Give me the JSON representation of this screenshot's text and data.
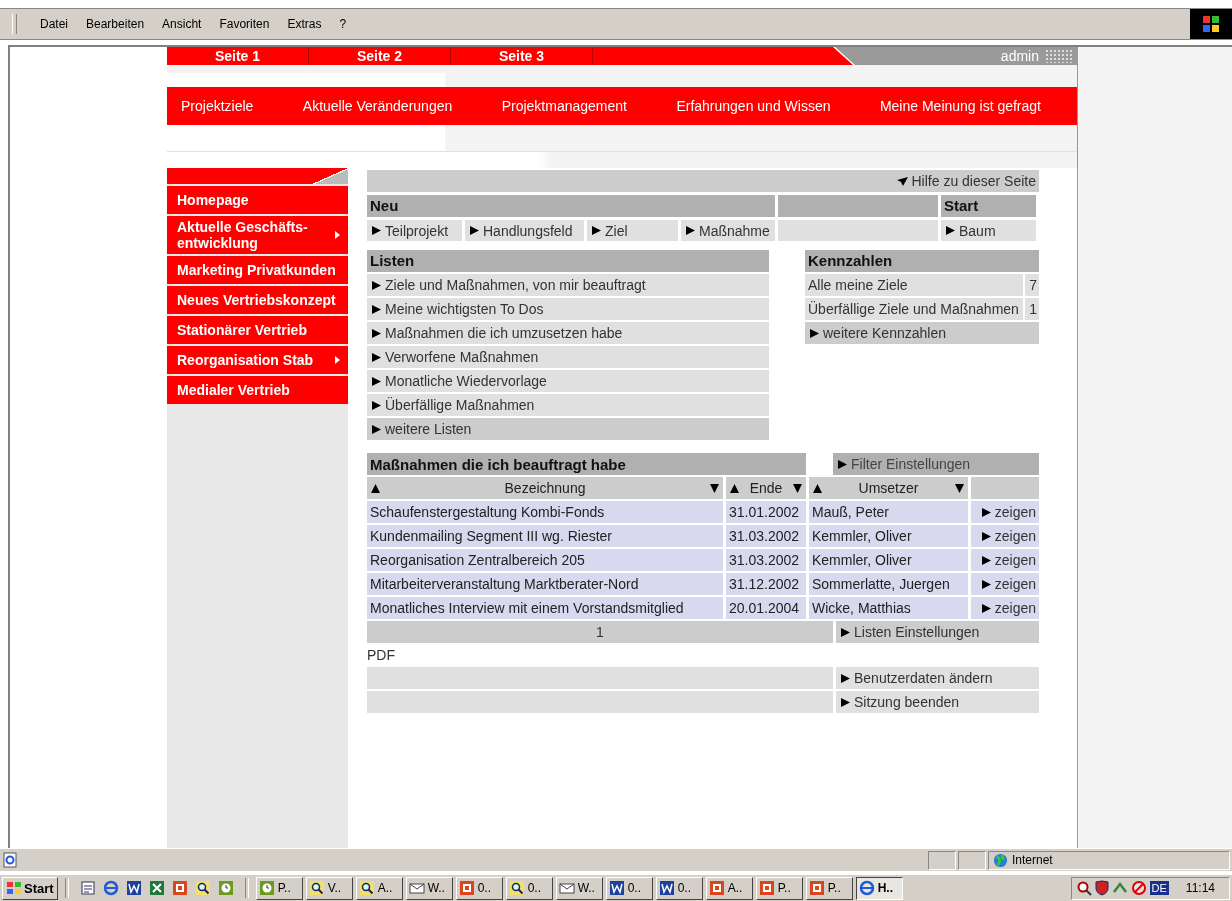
{
  "menu": [
    "Datei",
    "Bearbeiten",
    "Ansicht",
    "Favoriten",
    "Extras",
    "?"
  ],
  "page_tabs": [
    "Seite 1",
    "Seite 2",
    "Seite 3"
  ],
  "user": "admin",
  "nav": [
    "Projektziele",
    "Aktuelle Veränderungen",
    "Projektmanagement",
    "Erfahrungen und Wissen",
    "Meine Meinung ist gefragt"
  ],
  "sidebar": {
    "items": [
      {
        "label": "Homepage",
        "kind": "plain"
      },
      {
        "label": "Aktuelle Geschäfts-\nentwicklung",
        "kind": "submenu"
      },
      {
        "label": "Marketing Privatkunden",
        "kind": "plain"
      },
      {
        "label": "Neues Vertriebskonzept",
        "kind": "plain"
      },
      {
        "label": "Stationärer Vertrieb",
        "kind": "plain"
      },
      {
        "label": "Reorganisation Stab",
        "kind": "submenu"
      },
      {
        "label": "Medialer Vertrieb",
        "kind": "plain"
      }
    ]
  },
  "help_link": "Hilfe zu dieser Seite",
  "new_section": {
    "title": "Neu",
    "links": [
      "Teilprojekt",
      "Handlungsfeld",
      "Ziel",
      "Maßnahme"
    ],
    "start_title": "Start",
    "start_link": "Baum"
  },
  "lists": {
    "title": "Listen",
    "items": [
      {
        "label": "Ziele und Maßnahmen, von mir beauftragt",
        "kind": "link"
      },
      {
        "label": "Meine wichtigsten To Dos",
        "kind": "link"
      },
      {
        "label": "Maßnahmen die ich umzusetzen habe",
        "kind": "link"
      },
      {
        "label": "Verworfene Maßnahmen",
        "kind": "link"
      },
      {
        "label": "Monatliche Wiedervorlage",
        "kind": "link"
      },
      {
        "label": "Überfällige Maßnahmen",
        "kind": "link"
      },
      {
        "label": "weitere Listen",
        "kind": "more"
      }
    ]
  },
  "metrics": {
    "title": "Kennzahlen",
    "rows": [
      {
        "label": "Alle meine Ziele",
        "value": "7"
      },
      {
        "label": "Überfällige Ziele und Maßnahmen",
        "value": "1"
      }
    ],
    "more_link": "weitere Kennzahlen"
  },
  "table": {
    "title": "Maßnahmen die ich beauftragt habe",
    "filter_link": "Filter Einstellungen",
    "columns": [
      "Bezeichnung",
      "Ende",
      "Umsetzer"
    ],
    "rows": [
      {
        "name": "Schaufenstergestaltung Kombi-Fonds",
        "end": "31.01.2002",
        "owner": "Mauß, Peter",
        "action": "zeigen"
      },
      {
        "name": "Kundenmailing Segment III wg. Riester",
        "end": "31.03.2002",
        "owner": "Kemmler, Oliver",
        "action": "zeigen"
      },
      {
        "name": "Reorganisation Zentralbereich 205",
        "end": "31.03.2002",
        "owner": "Kemmler, Oliver",
        "action": "zeigen"
      },
      {
        "name": "Mitarbeiterveranstaltung Marktberater-Nord",
        "end": "31.12.2002",
        "owner": "Sommerlatte, Juergen",
        "action": "zeigen"
      },
      {
        "name": "Monatliches Interview mit einem Vorstandsmitglied",
        "end": "20.01.2004",
        "owner": "Wicke, Matthias",
        "action": "zeigen"
      }
    ],
    "page": "1",
    "settings_link": "Listen Einstellungen"
  },
  "pdf": "PDF",
  "user_links": [
    "Benutzerdaten ändern",
    "Sitzung beenden"
  ],
  "status_bar": {
    "zone": "Internet"
  },
  "taskbar": {
    "start": "Start",
    "quick_launch": [
      {
        "kind": "notepad"
      },
      {
        "kind": "browser"
      },
      {
        "kind": "word"
      },
      {
        "kind": "excel"
      },
      {
        "kind": "slides"
      },
      {
        "kind": "search"
      },
      {
        "kind": "clock"
      }
    ],
    "tasks": [
      {
        "label": "P..",
        "kind": "clock",
        "selected": false
      },
      {
        "label": "V..",
        "kind": "search",
        "selected": false
      },
      {
        "label": "A..",
        "kind": "search",
        "selected": false
      },
      {
        "label": "W..",
        "kind": "mail",
        "selected": false
      },
      {
        "label": "0..",
        "kind": "slides",
        "selected": false
      },
      {
        "label": "0..",
        "kind": "search",
        "selected": false
      },
      {
        "label": "W..",
        "kind": "mail",
        "selected": false
      },
      {
        "label": "0..",
        "kind": "word",
        "selected": false
      },
      {
        "label": "0..",
        "kind": "word",
        "selected": false
      },
      {
        "label": "A..",
        "kind": "slides",
        "selected": false
      },
      {
        "label": "P..",
        "kind": "slides",
        "selected": false
      },
      {
        "label": "P..",
        "kind": "slides",
        "selected": false
      },
      {
        "label": "H..",
        "kind": "browser",
        "selected": true
      }
    ],
    "language": "DE",
    "time": "11:14"
  }
}
